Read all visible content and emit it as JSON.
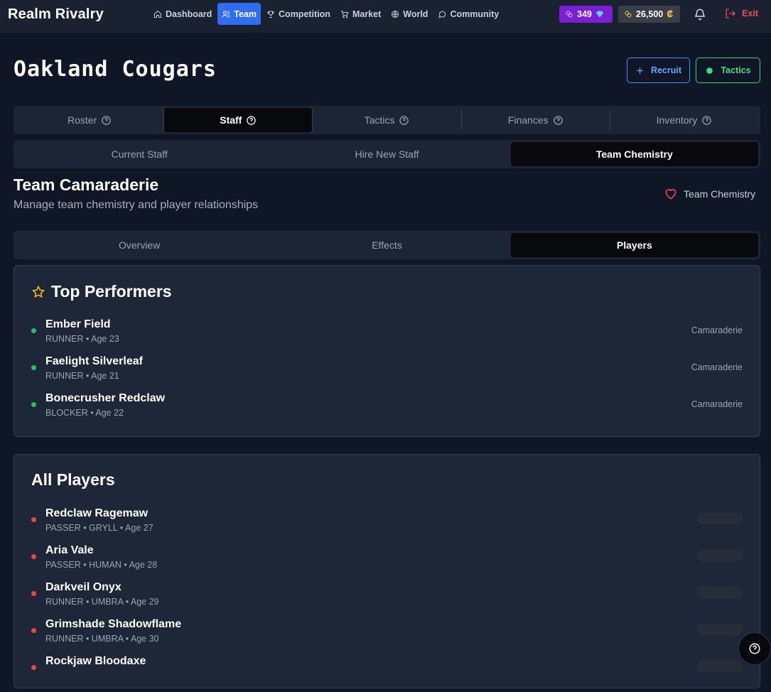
{
  "app": {
    "brand": "Realm Rivalry"
  },
  "nav": {
    "items": [
      {
        "label": "Dashboard",
        "icon": "home-icon",
        "active": false
      },
      {
        "label": "Team",
        "icon": "users-icon",
        "active": true
      },
      {
        "label": "Competition",
        "icon": "trophy-icon",
        "active": false
      },
      {
        "label": "Market",
        "icon": "cart-icon",
        "active": false
      },
      {
        "label": "World",
        "icon": "globe-icon",
        "active": false
      },
      {
        "label": "Community",
        "icon": "chat-icon",
        "active": false
      }
    ],
    "gems": "349",
    "coins": "26,500",
    "coin_symbol": "₡",
    "exit_label": "Exit"
  },
  "page": {
    "team_name": "Oakland Cougars",
    "recruit_label": "Recruit",
    "tactics_label": "Tactics"
  },
  "main_tabs": [
    {
      "label": "Roster",
      "active": false
    },
    {
      "label": "Staff",
      "active": true
    },
    {
      "label": "Tactics",
      "active": false
    },
    {
      "label": "Finances",
      "active": false
    },
    {
      "label": "Inventory",
      "active": false
    }
  ],
  "staff_tabs": [
    {
      "label": "Current Staff",
      "active": false
    },
    {
      "label": "Hire New Staff",
      "active": false
    },
    {
      "label": "Team Chemistry",
      "active": true
    }
  ],
  "camaraderie": {
    "title": "Team Camaraderie",
    "subtitle": "Manage team chemistry and player relationships",
    "badge": "Team Chemistry"
  },
  "chem_tabs": [
    {
      "label": "Overview",
      "active": false
    },
    {
      "label": "Effects",
      "active": false
    },
    {
      "label": "Players",
      "active": true
    }
  ],
  "top_performers": {
    "title": "Top Performers",
    "players": [
      {
        "name": "Ember Field",
        "meta": "RUNNER • Age 23",
        "right": "Camaraderie"
      },
      {
        "name": "Faelight Silverleaf",
        "meta": "RUNNER • Age 21",
        "right": "Camaraderie"
      },
      {
        "name": "Bonecrusher Redclaw",
        "meta": "BLOCKER • Age 22",
        "right": "Camaraderie"
      }
    ]
  },
  "all_players": {
    "title": "All Players",
    "players": [
      {
        "name": "Redclaw Ragemaw",
        "meta": "PASSER • GRYLL • Age 27"
      },
      {
        "name": "Aria Vale",
        "meta": "PASSER • HUMAN • Age 28"
      },
      {
        "name": "Darkveil Onyx",
        "meta": "RUNNER • UMBRA • Age 29"
      },
      {
        "name": "Grimshade Shadowflame",
        "meta": "RUNNER • UMBRA • Age 30"
      },
      {
        "name": "Rockjaw Bloodaxe",
        "meta": ""
      }
    ]
  },
  "colors": {
    "accent_blue": "#2f6df3",
    "gem_purple": "#7b1fd6",
    "success_green": "#22c55e",
    "danger_red": "#ef4444",
    "star_yellow": "#f5b50a"
  }
}
